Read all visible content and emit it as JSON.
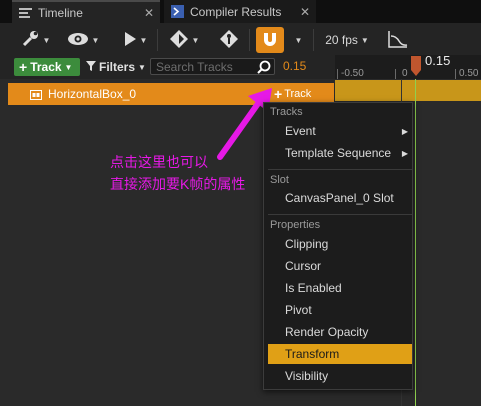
{
  "tabs": [
    {
      "label": "Timeline",
      "icon": "timeline-icon",
      "active": true
    },
    {
      "label": "Compiler Results",
      "icon": "compiler-results-icon",
      "active": false
    }
  ],
  "toolbar": {
    "fps": "20 fps"
  },
  "subbar": {
    "track_button": "Track",
    "filters_label": "Filters",
    "search_placeholder": "Search Tracks",
    "current_time": "0.15"
  },
  "ruler": {
    "labels": [
      "-0.50",
      "0",
      "0.50"
    ],
    "current": "0.15"
  },
  "track": {
    "name": "HorizontalBox_0",
    "add_label": "Track"
  },
  "menu": {
    "sections": [
      "Tracks",
      "Slot",
      "Properties"
    ],
    "items": [
      {
        "label": "Event"
      },
      {
        "label": "Template Sequence"
      },
      {
        "label": "CanvasPanel_0 Slot"
      },
      {
        "label": "Clipping"
      },
      {
        "label": "Cursor"
      },
      {
        "label": "Is Enabled"
      },
      {
        "label": "Pivot"
      },
      {
        "label": "Render Opacity"
      },
      {
        "label": "Transform",
        "selected": true
      },
      {
        "label": "Visibility"
      }
    ]
  },
  "annotation": {
    "line1": "点击这里也可以",
    "line2": "直接添加要K帧的属性"
  },
  "colors": {
    "accent_orange": "#e38a1a",
    "selection": "#e0a016",
    "annotation_magenta": "#e619e6",
    "green_button": "#3c8c3c"
  }
}
